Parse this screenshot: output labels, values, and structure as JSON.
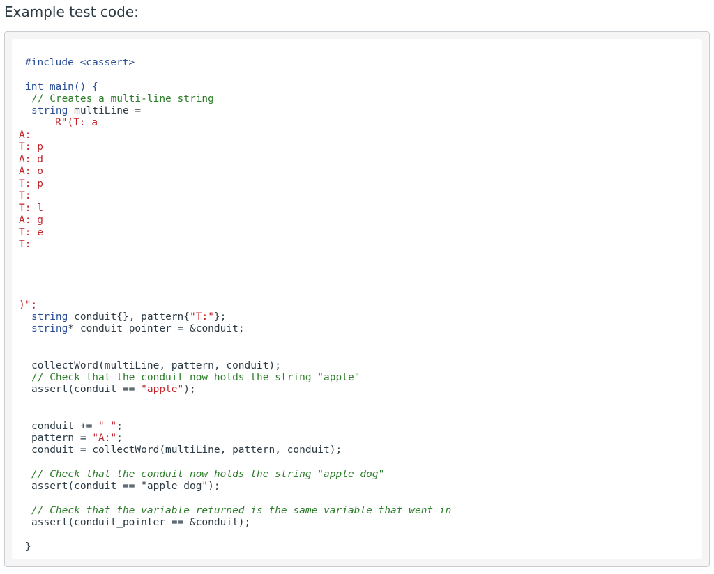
{
  "heading": "Example test code:",
  "code": {
    "include_line": "#include <cassert>",
    "main_sig": "int main() {",
    "comment_create": "// Creates a multi-line string",
    "decl_type": "string",
    "decl_rest": " multiLine =",
    "raw_start": "R\"(T: a",
    "raw_lines": [
      "A:",
      "T: p",
      "A: d",
      "A: o",
      "T: p",
      "T:",
      "T: l",
      "A: g",
      "T: e",
      "T:"
    ],
    "raw_end": ")\";",
    "l_conduit_type": "string",
    "l_conduit_mid": " conduit{}, pattern{",
    "l_conduit_str": "\"T:\"",
    "l_conduit_end": "};",
    "l_ptr_type": "string",
    "l_ptr_rest": "* conduit_pointer = &conduit;",
    "collect1": "collectWord(multiLine, pattern, conduit);",
    "comment_check1": "// Check that the conduit now holds the string \"apple\"",
    "assert1_pre": "assert(conduit == ",
    "assert1_str": "\"apple\"",
    "assert1_post": ");",
    "append_pre": "conduit += ",
    "append_str": "\" \"",
    "append_post": ";",
    "pattern_pre": "pattern = ",
    "pattern_str": "\"A:\"",
    "pattern_post": ";",
    "collect2": "conduit = collectWord(multiLine, pattern, conduit);",
    "comment_check2": "// Check that the conduit now holds the string \"apple dog\"",
    "assert2": "assert(conduit == \"apple dog\");",
    "comment_check3": "// Check that the variable returned is the same variable that went in",
    "assert3": "assert(conduit_pointer == &conduit);",
    "close_brace": "}"
  }
}
